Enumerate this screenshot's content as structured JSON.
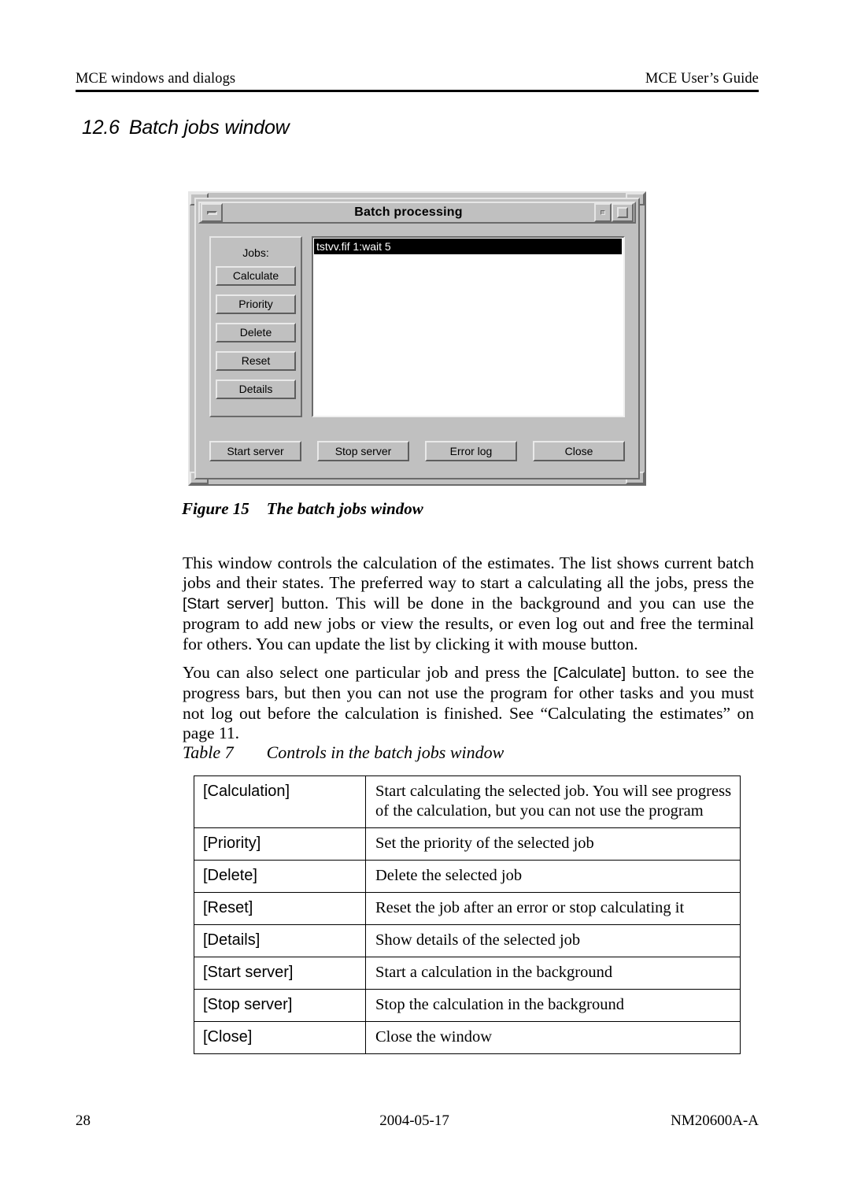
{
  "header": {
    "left": "MCE windows and dialogs",
    "right": "MCE User’s Guide"
  },
  "section": {
    "number": "12.6",
    "title": "Batch jobs window"
  },
  "figure": {
    "window": {
      "title": "Batch processing",
      "minimize_icon": "minimize-icon",
      "restore_icon": "restore-icon",
      "maximize_icon": "maximize-icon",
      "jobs_label": "Jobs:",
      "job_buttons": [
        "Calculate",
        "Priority",
        "Delete",
        "Reset",
        "Details"
      ],
      "list_items": [
        "tstvv.fif 1:wait 5"
      ],
      "action_buttons": [
        "Start server",
        "Stop server",
        "Error log",
        "Close"
      ]
    },
    "caption_label": "Figure 15",
    "caption_text": "The batch jobs window"
  },
  "body": {
    "paragraph_1_part_1": "This window controls the calculation of the estimates. The list shows current batch jobs and their states. The preferred way to start a calculating all the jobs, press the ",
    "paragraph_1_ref": "[Start server]",
    "paragraph_1_part_2": " button. This will be done in the background and you can use the program to add new jobs or view the results, or even log out and free the terminal for others. You can update the list by clicking it with mouse button.",
    "paragraph_2_part_1": "You can also select one particular job and press the ",
    "paragraph_2_ref": "[Calculate]",
    "paragraph_2_part_2": " button. to see the progress bars, but then you can not use the program for other tasks and you must not log out before the calculation is finished. See “Calculating the estimates” on page 11."
  },
  "table": {
    "caption_label": "Table 7",
    "caption_text": "Controls in the batch jobs window",
    "rows": [
      {
        "control": "[Calculation]",
        "description": "Start calculating the selected job. You will see progress of the calculation, but you can not use the program"
      },
      {
        "control": "[Priority]",
        "description": "Set the priority of the selected job"
      },
      {
        "control": "[Delete]",
        "description": "Delete the selected job"
      },
      {
        "control": "[Reset]",
        "description": "Reset the job after an error or stop calculating it"
      },
      {
        "control": "[Details]",
        "description": "Show details of the selected job"
      },
      {
        "control": "[Start server]",
        "description": "Start a calculation in the background"
      },
      {
        "control": "[Stop server]",
        "description": "Stop the calculation in the background"
      },
      {
        "control": "[Close]",
        "description": "Close the window"
      }
    ]
  },
  "footer": {
    "page_number": "28",
    "date": "2004-05-17",
    "document_id": "NM20600A-A"
  }
}
